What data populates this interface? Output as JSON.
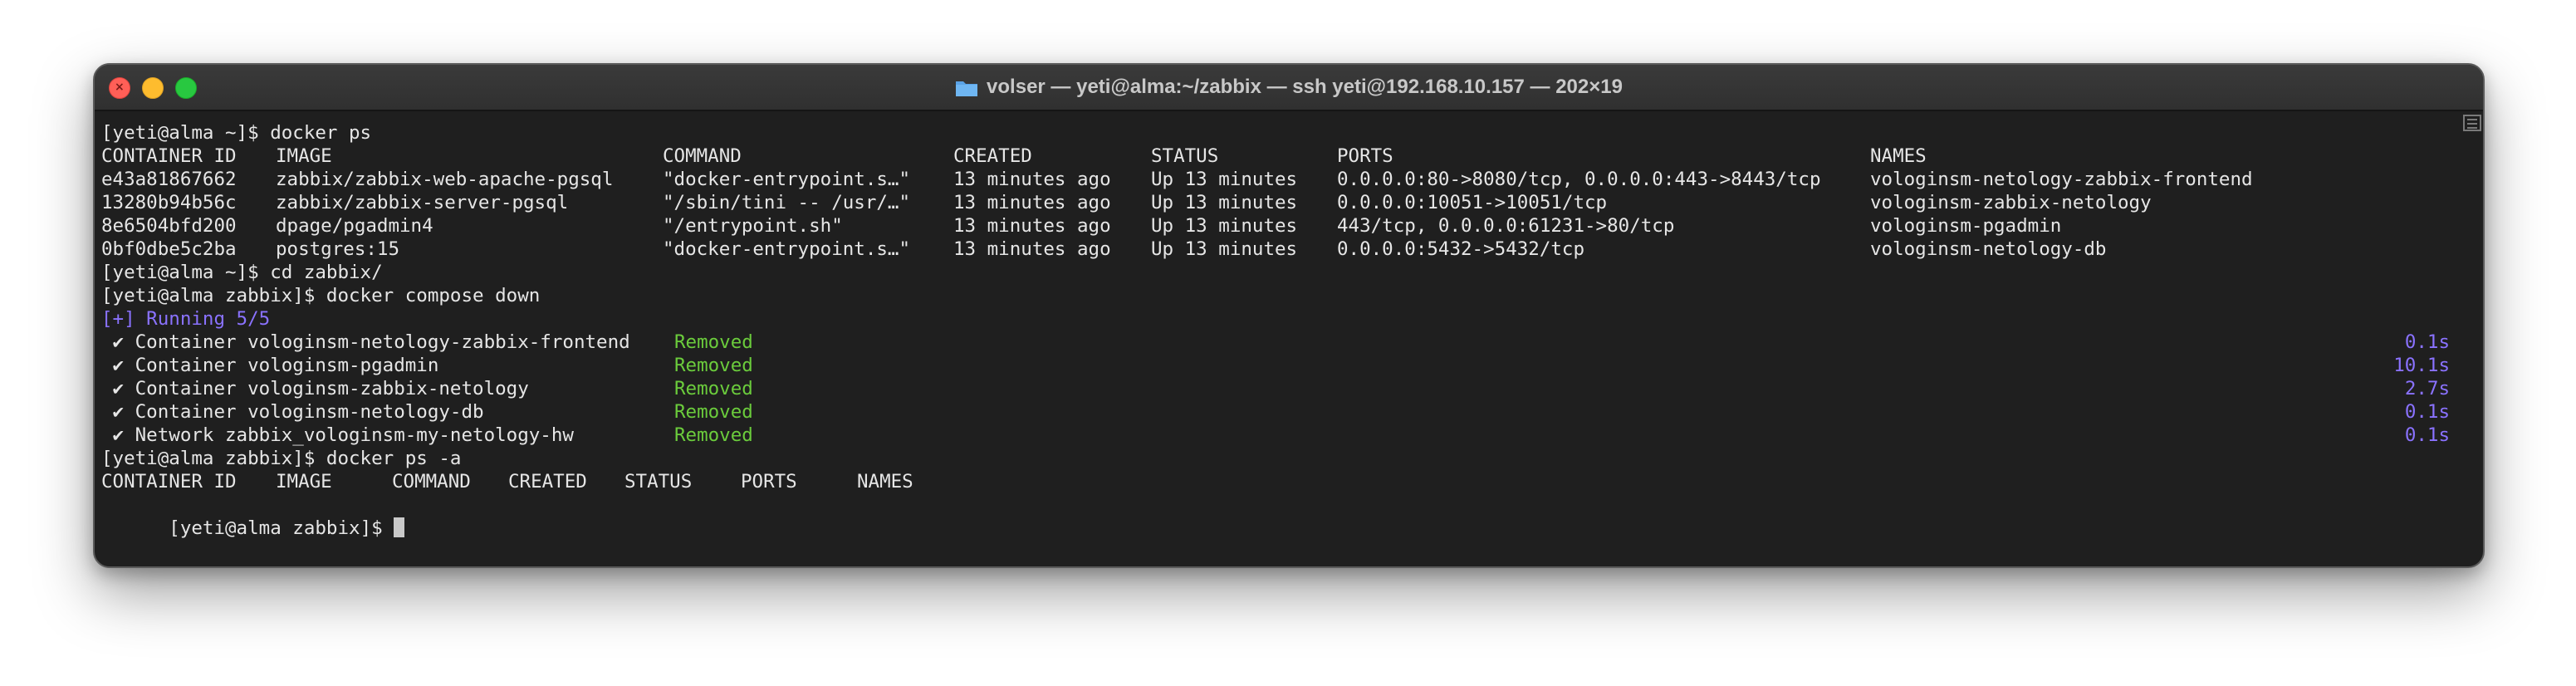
{
  "window": {
    "title": "volser — yeti@alma:~/zabbix — ssh yeti@192.168.10.157 — 202×19"
  },
  "terminal": {
    "prompt1": "[yeti@alma ~]$ docker ps",
    "ps_headers": [
      "CONTAINER ID",
      "IMAGE",
      "COMMAND",
      "CREATED",
      "STATUS",
      "PORTS",
      "NAMES"
    ],
    "ps_rows": [
      [
        "e43a81867662",
        "zabbix/zabbix-web-apache-pgsql",
        "\"docker-entrypoint.s…\"",
        "13 minutes ago",
        "Up 13 minutes",
        "0.0.0.0:80->8080/tcp, 0.0.0.0:443->8443/tcp",
        "vologinsm-netology-zabbix-frontend"
      ],
      [
        "13280b94b56c",
        "zabbix/zabbix-server-pgsql",
        "\"/sbin/tini -- /usr/…\"",
        "13 minutes ago",
        "Up 13 minutes",
        "0.0.0.0:10051->10051/tcp",
        "vologinsm-zabbix-netology"
      ],
      [
        "8e6504bfd200",
        "dpage/pgadmin4",
        "\"/entrypoint.sh\"",
        "13 minutes ago",
        "Up 13 minutes",
        "443/tcp, 0.0.0.0:61231->80/tcp",
        "vologinsm-pgadmin"
      ],
      [
        "0bf0dbe5c2ba",
        "postgres:15",
        "\"docker-entrypoint.s…\"",
        "13 minutes ago",
        "Up 13 minutes",
        "0.0.0.0:5432->5432/tcp",
        "vologinsm-netology-db"
      ]
    ],
    "prompt2": "[yeti@alma ~]$ cd zabbix/",
    "prompt3": "[yeti@alma zabbix]$ docker compose down",
    "running": "[+] Running 5/5",
    "removals": [
      {
        "item": " ✔ Container vologinsm-netology-zabbix-frontend",
        "status": "Removed",
        "time": "0.1s"
      },
      {
        "item": " ✔ Container vologinsm-pgadmin",
        "status": "Removed",
        "time": "10.1s"
      },
      {
        "item": " ✔ Container vologinsm-zabbix-netology",
        "status": "Removed",
        "time": "2.7s"
      },
      {
        "item": " ✔ Container vologinsm-netology-db",
        "status": "Removed",
        "time": "0.1s"
      },
      {
        "item": " ✔ Network zabbix_vologinsm-my-netology-hw",
        "status": "Removed",
        "time": "0.1s"
      }
    ],
    "prompt4": "[yeti@alma zabbix]$ docker ps -a",
    "psa_headers": [
      "CONTAINER ID",
      "IMAGE",
      "COMMAND",
      "CREATED",
      "STATUS",
      "PORTS",
      "NAMES"
    ],
    "prompt5": "[yeti@alma zabbix]$ "
  },
  "colors": {
    "background": "#1f1f1f",
    "text": "#e6e6e6",
    "accent_purple": "#8a72ff",
    "success_green": "#6bcc3c"
  }
}
